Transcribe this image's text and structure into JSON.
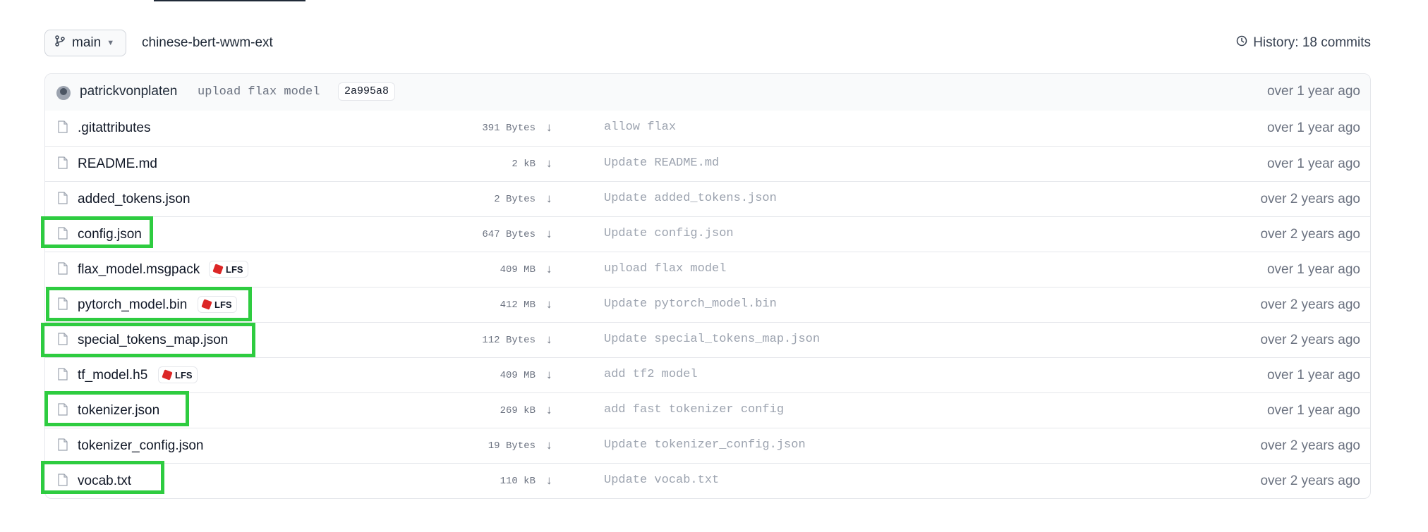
{
  "header": {
    "branch": "main",
    "repo": "chinese-bert-wwm-ext",
    "history": "History: 18 commits"
  },
  "last_commit": {
    "author": "patrickvonplaten",
    "message": "upload flax model",
    "hash": "2a995a8",
    "time": "over 1 year ago"
  },
  "files": [
    {
      "name": ".gitattributes",
      "size": "391 Bytes",
      "message": "allow flax",
      "time": "over 1 year ago",
      "lfs": ""
    },
    {
      "name": "README.md",
      "size": "2 kB",
      "message": "Update README.md",
      "time": "over 1 year ago",
      "lfs": ""
    },
    {
      "name": "added_tokens.json",
      "size": "2 Bytes",
      "message": "Update added_tokens.json",
      "time": "over 2 years ago",
      "lfs": ""
    },
    {
      "name": "config.json",
      "size": "647 Bytes",
      "message": "Update config.json",
      "time": "over 2 years ago",
      "lfs": ""
    },
    {
      "name": "flax_model.msgpack",
      "size": "409 MB",
      "message": "upload flax model",
      "time": "over 1 year ago",
      "lfs": "LFS"
    },
    {
      "name": "pytorch_model.bin",
      "size": "412 MB",
      "message": "Update pytorch_model.bin",
      "time": "over 2 years ago",
      "lfs": "LFS"
    },
    {
      "name": "special_tokens_map.json",
      "size": "112 Bytes",
      "message": "Update special_tokens_map.json",
      "time": "over 2 years ago",
      "lfs": ""
    },
    {
      "name": "tf_model.h5",
      "size": "409 MB",
      "message": "add tf2 model",
      "time": "over 1 year ago",
      "lfs": "LFS"
    },
    {
      "name": "tokenizer.json",
      "size": "269 kB",
      "message": "add fast tokenizer config",
      "time": "over 1 year ago",
      "lfs": ""
    },
    {
      "name": "tokenizer_config.json",
      "size": "19 Bytes",
      "message": "Update tokenizer_config.json",
      "time": "over 2 years ago",
      "lfs": ""
    },
    {
      "name": "vocab.txt",
      "size": "110 kB",
      "message": "Update vocab.txt",
      "time": "over 2 years ago",
      "lfs": ""
    }
  ],
  "colors": {
    "highlight": "#2ecc40",
    "lfs_icon": "#dc2626"
  },
  "icons": {
    "branch": "branch-icon",
    "history": "clock-icon",
    "file": "file-icon",
    "download": "download-arrow-icon"
  }
}
